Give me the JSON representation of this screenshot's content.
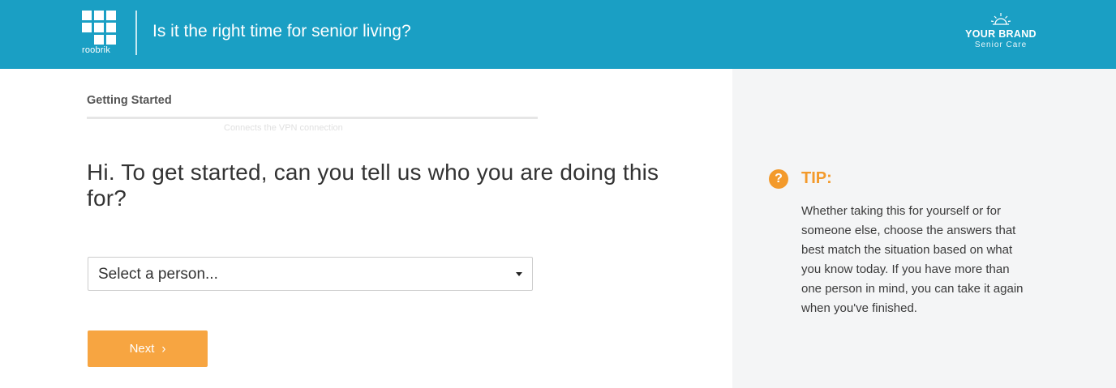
{
  "header": {
    "logo_text": "roobrik",
    "title": "Is it the right time for senior living?",
    "brand": {
      "name": "YOUR BRAND",
      "subtitle": "Senior Care",
      "icon": "sunrise-icon"
    }
  },
  "main": {
    "step_label": "Getting Started",
    "ghost_tooltip": "Connects the VPN connection",
    "question": "Hi. To get started, can you tell us who you are doing this for?",
    "select": {
      "value": "Select a person..."
    },
    "next_button": {
      "label": "Next",
      "chevron": "›"
    }
  },
  "aside": {
    "tip_icon": "?",
    "tip_title": "TIP:",
    "tip_body": "Whether taking this for yourself or for someone else, choose the answers that best match the situation based on what you know today. If you have more than one person in mind, you can take it again when you've finished."
  },
  "colors": {
    "header_bg": "#1a9fc4",
    "accent_orange": "#f7a541",
    "tip_orange": "#f39a2b",
    "aside_bg": "#f4f5f6"
  }
}
